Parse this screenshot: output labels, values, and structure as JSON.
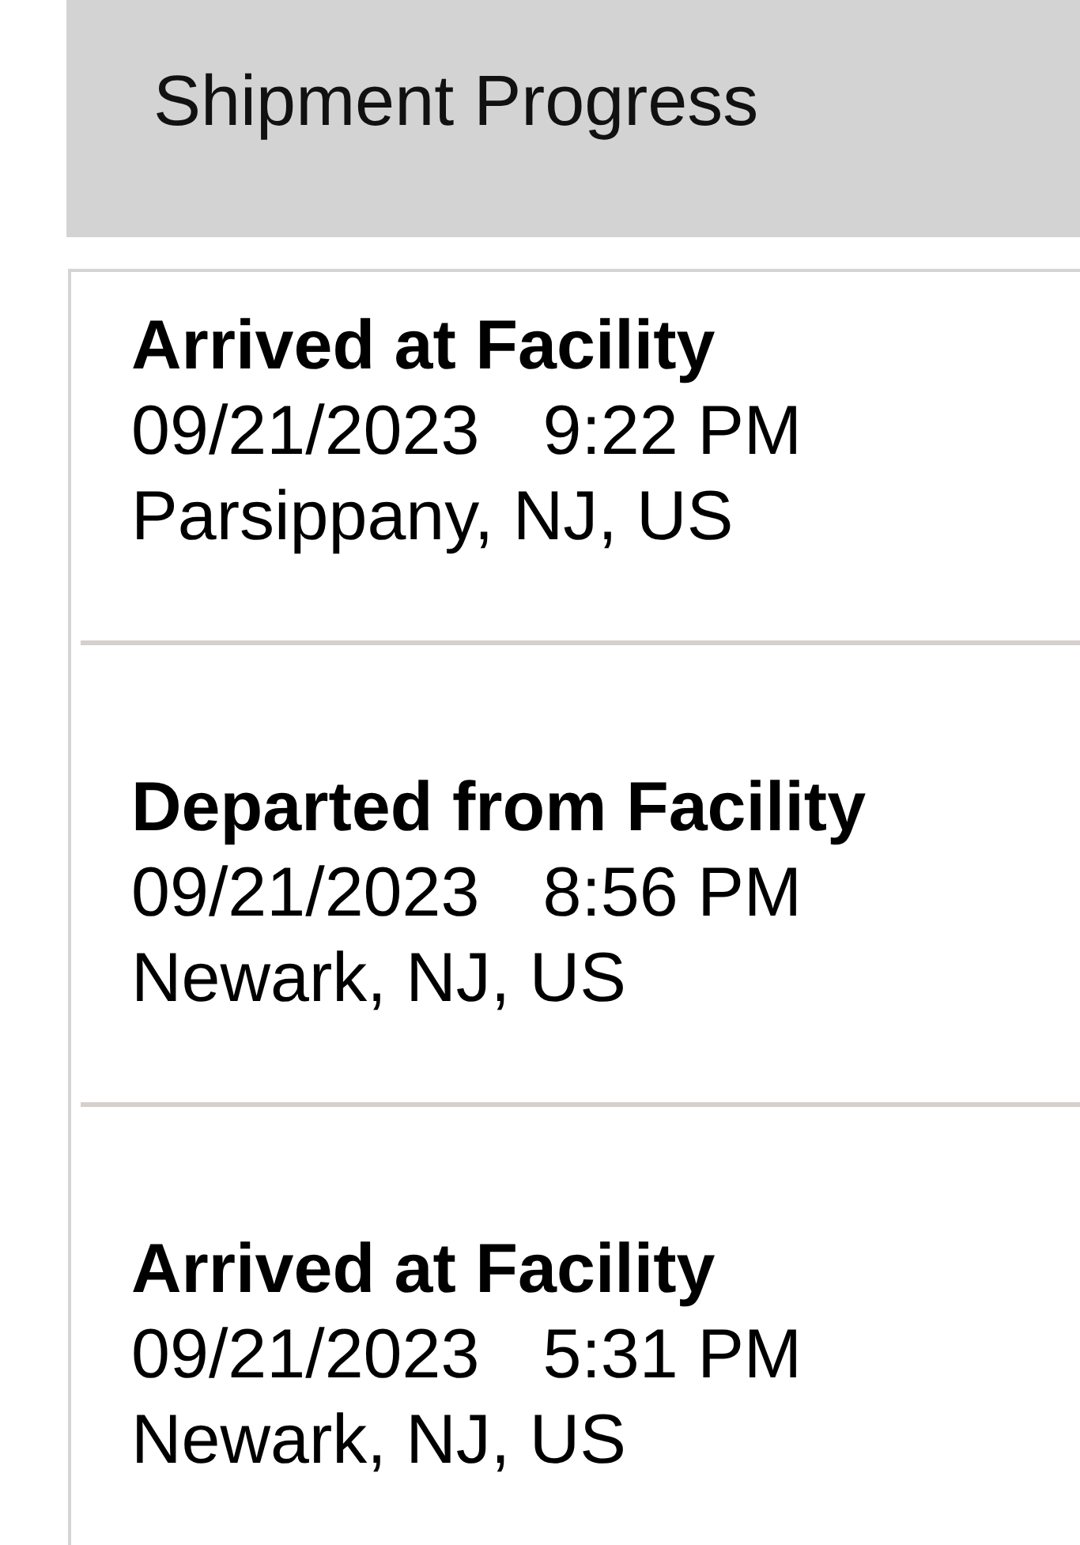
{
  "header": {
    "title": "Shipment Progress"
  },
  "events": [
    {
      "status": "Arrived at Facility",
      "date": "09/21/2023",
      "time": "9:22 PM",
      "location": "Parsippany, NJ, US"
    },
    {
      "status": "Departed from Facility",
      "date": "09/21/2023",
      "time": "8:56 PM",
      "location": "Newark, NJ, US"
    },
    {
      "status": "Arrived at Facility",
      "date": "09/21/2023",
      "time": "5:31 PM",
      "location": "Newark, NJ, US"
    }
  ]
}
